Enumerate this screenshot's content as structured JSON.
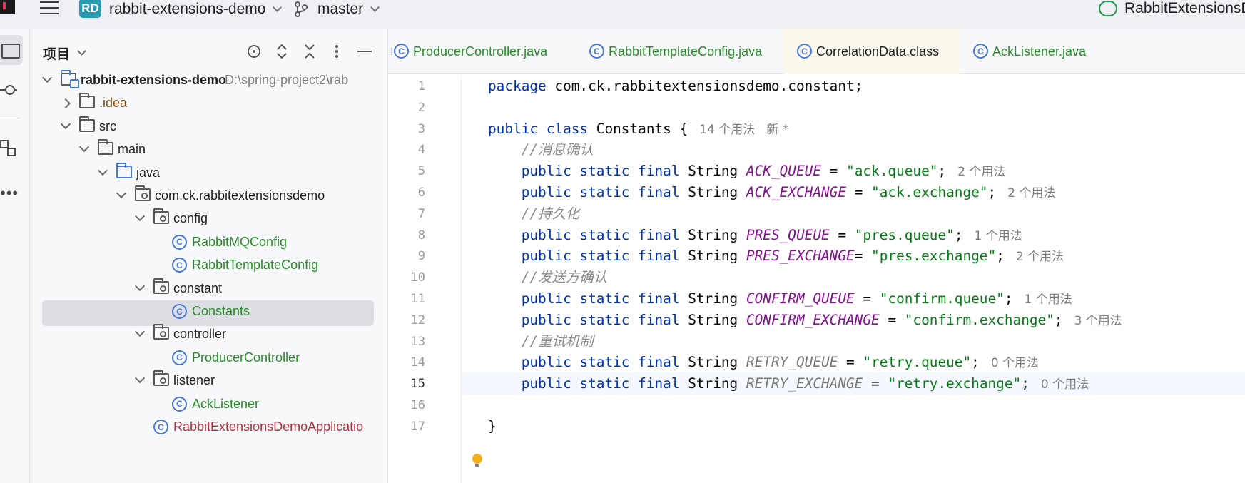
{
  "titlebar": {
    "project_badge": "RD",
    "project_name": "rabbit-extensions-demo",
    "branch": "master",
    "run_config": "RabbitExtensionsDe"
  },
  "project_panel": {
    "title": "项目",
    "tree": [
      {
        "label": "rabbit-extensions-demo",
        "path": "D:\\spring-project2\\rab",
        "kind": "module",
        "depth": 0,
        "state": "expanded"
      },
      {
        "label": ".idea",
        "kind": "folder",
        "depth": 1,
        "state": "collapsed"
      },
      {
        "label": "src",
        "kind": "folder",
        "depth": 1,
        "state": "expanded"
      },
      {
        "label": "main",
        "kind": "folder",
        "depth": 2,
        "state": "expanded"
      },
      {
        "label": "java",
        "kind": "source-folder",
        "depth": 3,
        "state": "expanded"
      },
      {
        "label": "com.ck.rabbitextensionsdemo",
        "kind": "package",
        "depth": 4,
        "state": "expanded"
      },
      {
        "label": "config",
        "kind": "package",
        "depth": 5,
        "state": "expanded"
      },
      {
        "label": "RabbitMQConfig",
        "kind": "class",
        "depth": 6
      },
      {
        "label": "RabbitTemplateConfig",
        "kind": "class",
        "depth": 6
      },
      {
        "label": "constant",
        "kind": "package",
        "depth": 5,
        "state": "expanded"
      },
      {
        "label": "Constants",
        "kind": "class",
        "depth": 6,
        "selected": true
      },
      {
        "label": "controller",
        "kind": "package",
        "depth": 5,
        "state": "expanded"
      },
      {
        "label": "ProducerController",
        "kind": "class",
        "depth": 6
      },
      {
        "label": "listener",
        "kind": "package",
        "depth": 5,
        "state": "expanded"
      },
      {
        "label": "AckListener",
        "kind": "class",
        "depth": 6
      },
      {
        "label": "RabbitExtensionsDemoApplicatio",
        "kind": "app-class",
        "depth": 5
      }
    ]
  },
  "editor": {
    "tabs": [
      {
        "label": "ProducerController.java",
        "active": false
      },
      {
        "label": "RabbitTemplateConfig.java",
        "active": false
      },
      {
        "label": "CorrelationData.class",
        "active": true
      },
      {
        "label": "AckListener.java",
        "active": false
      }
    ],
    "current_line": 15,
    "lines": [
      {
        "n": "1",
        "tokens": [
          [
            "kw",
            "package"
          ],
          [
            "p",
            " com.ck.rabbitextensionsdemo.constant;"
          ]
        ]
      },
      {
        "n": "2",
        "tokens": []
      },
      {
        "n": "3",
        "tokens": [
          [
            "kw",
            "public class"
          ],
          [
            "p",
            " Constants {"
          ]
        ],
        "hint": "14 个用法   新 *"
      },
      {
        "n": "4",
        "tokens": [
          [
            "p",
            "    "
          ],
          [
            "cmt",
            "//消息确认"
          ]
        ]
      },
      {
        "n": "5",
        "tokens": [
          [
            "p",
            "    "
          ],
          [
            "kw",
            "public static final"
          ],
          [
            "p",
            " String "
          ],
          [
            "const",
            "ACK_QUEUE"
          ],
          [
            "p",
            " = "
          ],
          [
            "str",
            "\"ack.queue\""
          ],
          [
            "p",
            ";"
          ]
        ],
        "hint": "2 个用法"
      },
      {
        "n": "6",
        "tokens": [
          [
            "p",
            "    "
          ],
          [
            "kw",
            "public static final"
          ],
          [
            "p",
            " String "
          ],
          [
            "const",
            "ACK_EXCHANGE"
          ],
          [
            "p",
            " = "
          ],
          [
            "str",
            "\"ack.exchange\""
          ],
          [
            "p",
            ";"
          ]
        ],
        "hint": "2 个用法"
      },
      {
        "n": "7",
        "tokens": [
          [
            "p",
            "    "
          ],
          [
            "cmt",
            "//持久化"
          ]
        ]
      },
      {
        "n": "8",
        "tokens": [
          [
            "p",
            "    "
          ],
          [
            "kw",
            "public static final"
          ],
          [
            "p",
            " String "
          ],
          [
            "const",
            "PRES_QUEUE"
          ],
          [
            "p",
            " = "
          ],
          [
            "str",
            "\"pres.queue\""
          ],
          [
            "p",
            ";"
          ]
        ],
        "hint": "1 个用法"
      },
      {
        "n": "9",
        "tokens": [
          [
            "p",
            "    "
          ],
          [
            "kw",
            "public static final"
          ],
          [
            "p",
            " String "
          ],
          [
            "const",
            "PRES_EXCHANGE"
          ],
          [
            "p",
            "= "
          ],
          [
            "str",
            "\"pres.exchange\""
          ],
          [
            "p",
            ";"
          ]
        ],
        "hint": "2 个用法"
      },
      {
        "n": "10",
        "tokens": [
          [
            "p",
            "    "
          ],
          [
            "cmt",
            "//发送方确认"
          ]
        ]
      },
      {
        "n": "11",
        "tokens": [
          [
            "p",
            "    "
          ],
          [
            "kw",
            "public static final"
          ],
          [
            "p",
            " String "
          ],
          [
            "const",
            "CONFIRM_QUEUE"
          ],
          [
            "p",
            " = "
          ],
          [
            "str",
            "\"confirm.queue\""
          ],
          [
            "p",
            ";"
          ]
        ],
        "hint": "1 个用法"
      },
      {
        "n": "12",
        "tokens": [
          [
            "p",
            "    "
          ],
          [
            "kw",
            "public static final"
          ],
          [
            "p",
            " String "
          ],
          [
            "const",
            "CONFIRM_EXCHANGE"
          ],
          [
            "p",
            " = "
          ],
          [
            "str",
            "\"confirm.exchange\""
          ],
          [
            "p",
            ";"
          ]
        ],
        "hint": "3 个用法"
      },
      {
        "n": "13",
        "tokens": [
          [
            "p",
            "    "
          ],
          [
            "cmt",
            "//重试机制"
          ]
        ]
      },
      {
        "n": "14",
        "tokens": [
          [
            "p",
            "    "
          ],
          [
            "kw",
            "public static final"
          ],
          [
            "p",
            " String "
          ],
          [
            "unused",
            "RETRY_QUEUE"
          ],
          [
            "p",
            " = "
          ],
          [
            "str",
            "\"retry.queue\""
          ],
          [
            "p",
            ";"
          ]
        ],
        "hint": "0 个用法"
      },
      {
        "n": "15",
        "tokens": [
          [
            "p",
            "    "
          ],
          [
            "kw",
            "public static final"
          ],
          [
            "p",
            " String "
          ],
          [
            "unused",
            "RETRY_EXCHANGE"
          ],
          [
            "p",
            " = "
          ],
          [
            "str",
            "\"retry.exchange\""
          ],
          [
            "p",
            ";"
          ]
        ],
        "hint": "0 个用法"
      },
      {
        "n": "16",
        "tokens": []
      },
      {
        "n": "17",
        "tokens": [
          [
            "p",
            "}"
          ]
        ]
      }
    ]
  },
  "colors": {
    "keyword": "#0033b3",
    "constant": "#871094",
    "string": "#067d17",
    "comment": "#8c8c8c",
    "class_name": "#2a8a2a",
    "selection": "#dcdee3"
  }
}
